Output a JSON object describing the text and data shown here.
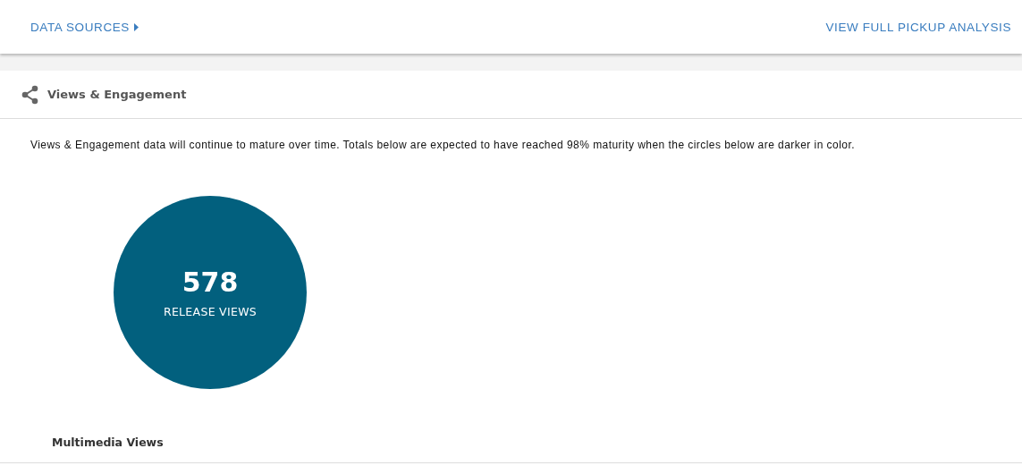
{
  "top_bar": {
    "data_sources_link": "DATA SOURCES",
    "analysis_link": "VIEW FULL PICKUP ANALYSIS"
  },
  "section": {
    "title": "Views & Engagement",
    "note": "Views & Engagement data will continue to mature over time. Totals below are expected to have reached 98% maturity when the circles below are darker in color.",
    "metrics": [
      {
        "value": "578",
        "label": "RELEASE VIEWS",
        "mature": true
      }
    ],
    "subsection": "Multimedia Views"
  }
}
